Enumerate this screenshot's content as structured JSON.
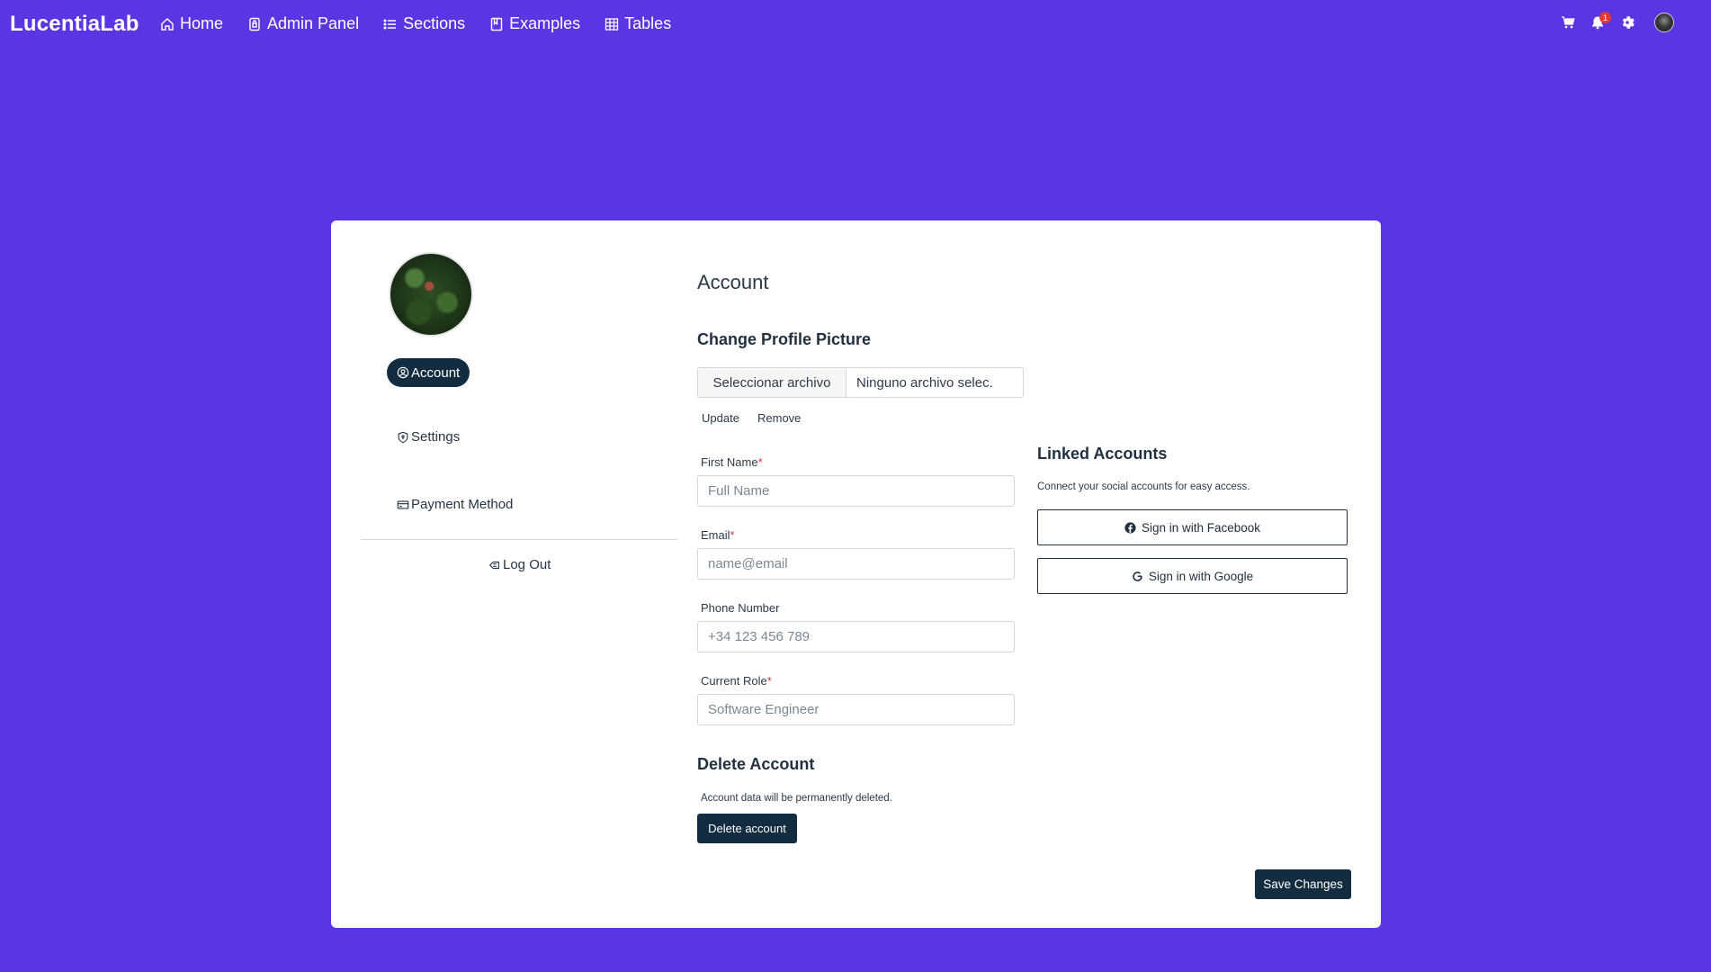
{
  "nav": {
    "brand": "LucentiaLab",
    "links": [
      {
        "label": "Home",
        "icon": "home-icon"
      },
      {
        "label": "Admin Panel",
        "icon": "lock-icon"
      },
      {
        "label": "Sections",
        "icon": "list-icon"
      },
      {
        "label": "Examples",
        "icon": "bookmark-icon"
      },
      {
        "label": "Tables",
        "icon": "table-icon"
      }
    ],
    "notification_count": "1",
    "right_icons": [
      "cart-icon",
      "bell-icon",
      "gear-icon",
      "avatar"
    ]
  },
  "sidebar": {
    "items": [
      {
        "label": "Account",
        "icon": "user-circle-icon",
        "active": true
      },
      {
        "label": "Settings",
        "icon": "shield-icon"
      },
      {
        "label": "Payment Method",
        "icon": "credit-card-icon"
      },
      {
        "label": "Log Out",
        "icon": "logout-icon"
      }
    ]
  },
  "main": {
    "title": "Account",
    "change_picture": {
      "heading": "Change Profile Picture",
      "file_button": "Seleccionar archivo",
      "file_status": "Ninguno archivo selec.",
      "update": "Update",
      "remove": "Remove"
    },
    "fields": [
      {
        "label": "First Name",
        "required": true,
        "placeholder": "Full Name"
      },
      {
        "label": "Email",
        "required": true,
        "placeholder": "name@email"
      },
      {
        "label": "Phone Number",
        "required": false,
        "placeholder": "+34 123 456 789"
      },
      {
        "label": "Current Role",
        "required": true,
        "placeholder": "Software Engineer"
      }
    ],
    "delete": {
      "heading": "Delete Account",
      "note": "Account data will be permanently deleted.",
      "button": "Delete account"
    },
    "linked": {
      "heading": "Linked Accounts",
      "note": "Connect your social accounts for easy access.",
      "facebook": "Sign in with Facebook",
      "google": "Sign in with Google"
    },
    "save": "Save Changes"
  },
  "colors": {
    "background": "#5a35e1",
    "primary_dark": "#132c3f",
    "required": "#e53935"
  }
}
